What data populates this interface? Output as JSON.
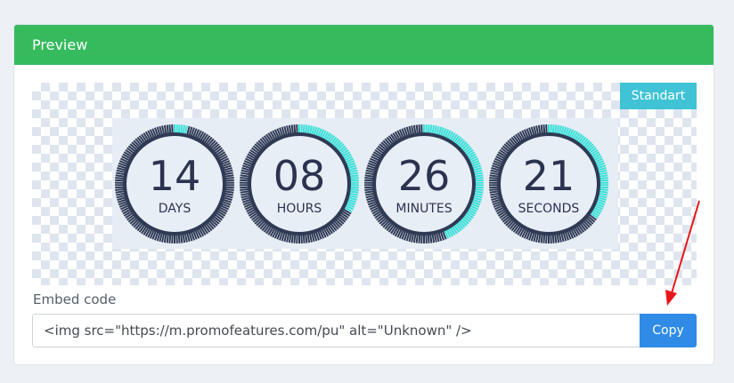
{
  "card": {
    "title": "Preview"
  },
  "preview": {
    "style_badge": "Standart",
    "countdown": [
      {
        "value": "14",
        "label": "DAYS",
        "progress": 0.04
      },
      {
        "value": "08",
        "label": "HOURS",
        "progress": 0.33
      },
      {
        "value": "26",
        "label": "MINUTES",
        "progress": 0.44
      },
      {
        "value": "21",
        "label": "SECONDS",
        "progress": 0.35
      }
    ],
    "colors": {
      "progress": "#38e0d8",
      "ring": "#2f3a55",
      "face": "#e8eef6",
      "text": "#2b3350"
    }
  },
  "embed": {
    "label": "Embed code",
    "value": "<img src=\"https://m.promofeatures.com/pu\" alt=\"Unknown\" />",
    "copy_label": "Copy"
  },
  "colors": {
    "header": "#35bb5d",
    "badge": "#3fc3d5",
    "copy_button": "#2f8be6",
    "annotation_arrow": "#e8161b"
  }
}
